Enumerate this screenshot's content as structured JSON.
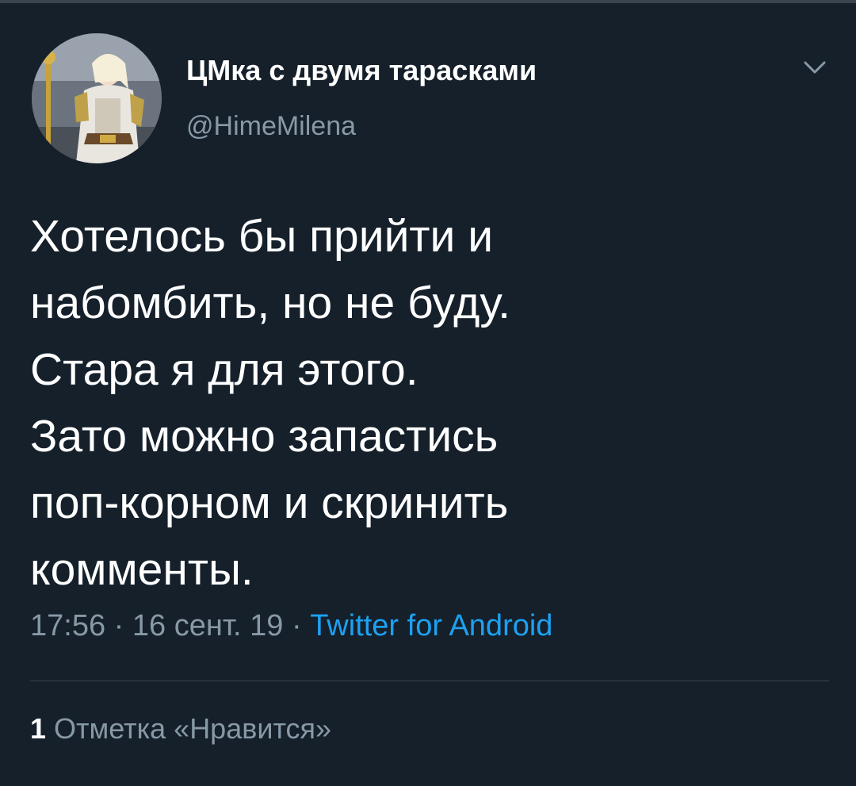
{
  "colors": {
    "background": "#15202b",
    "primary_text": "#ffffff",
    "secondary_text": "#8899a6",
    "link": "#1da1f2",
    "divider": "#38444d"
  },
  "author": {
    "display_name": "ЦМка с двумя тарасками",
    "handle": "@HimeMilena",
    "avatar_icon": "cosplay-photo-avatar"
  },
  "menu": {
    "icon": "chevron-down-icon"
  },
  "tweet": {
    "lines": [
      "Хотелось бы прийти и",
      "набомбить, но не буду.",
      "Стара я для этого.",
      "Зато можно запастись",
      "поп-корном и скринить",
      "комменты."
    ]
  },
  "meta": {
    "time": "17:56",
    "separator": " · ",
    "date": "16 сент. 19",
    "source": "Twitter for Android"
  },
  "stats": {
    "likes_count": "1",
    "likes_label": "Отметка «Нравится»"
  }
}
